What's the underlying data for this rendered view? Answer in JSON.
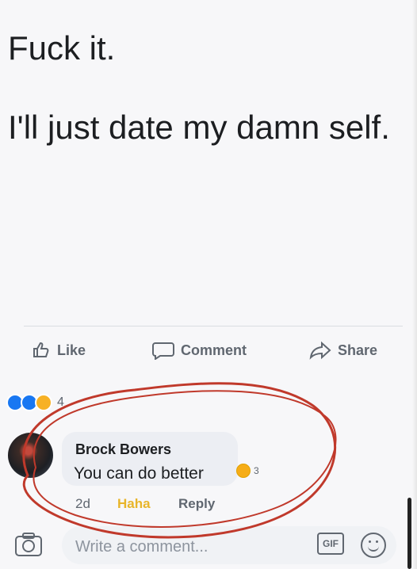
{
  "post": {
    "line1": "Fuck it.",
    "line2": "I'll just date my damn self."
  },
  "actions": {
    "like": "Like",
    "comment": "Comment",
    "share": "Share"
  },
  "reactions": {
    "count": "4"
  },
  "comment": {
    "author": "Brock Bowers",
    "text": "You can do better",
    "reaction_count": "3",
    "time": "2d",
    "haha": "Haha",
    "reply": "Reply"
  },
  "composer": {
    "placeholder": "Write a comment...",
    "gif": "GIF"
  },
  "colors": {
    "accent": "#1877f2",
    "text": "#1c1e21",
    "muted": "#606770",
    "haha": "#e8b52a",
    "annotation": "#c0392b"
  },
  "icons": [
    "thumb-up-icon",
    "comment-icon",
    "share-icon",
    "camera-icon",
    "gif-icon",
    "smile-icon"
  ]
}
